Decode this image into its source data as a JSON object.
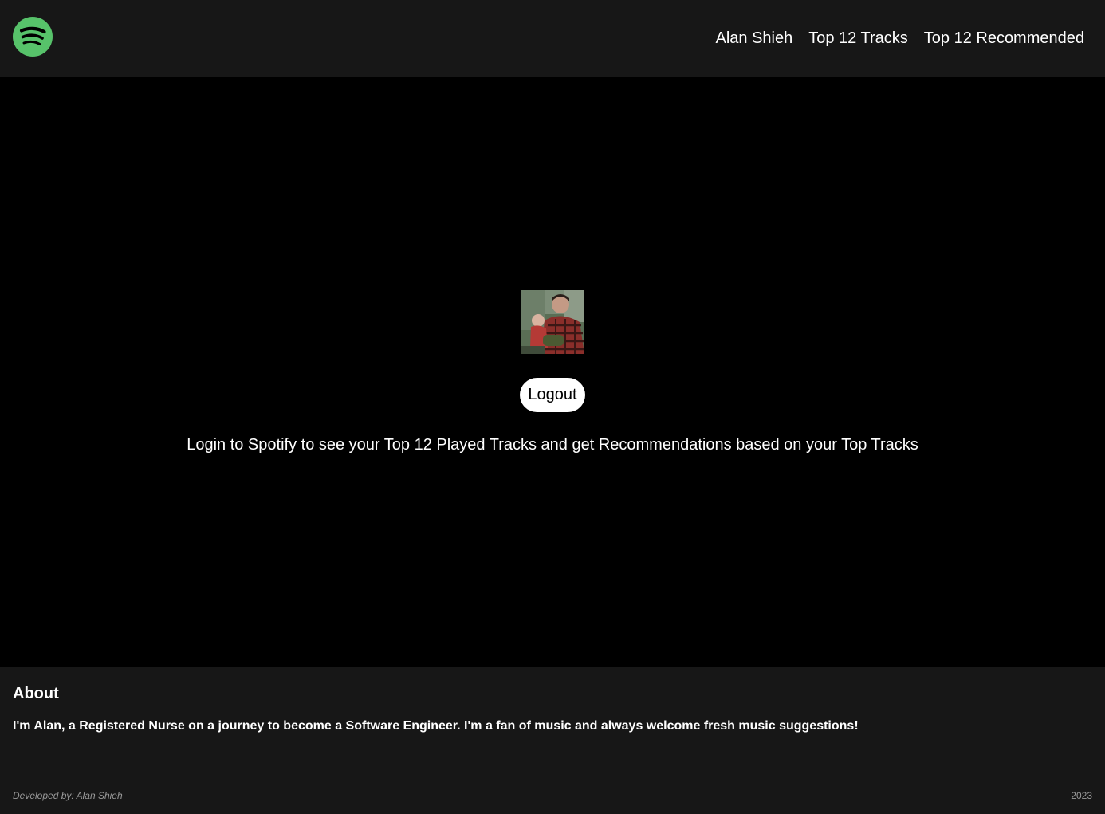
{
  "header": {
    "logo_icon": "spotify-logo-icon",
    "nav": [
      {
        "label": "Alan Shieh"
      },
      {
        "label": "Top 12 Tracks"
      },
      {
        "label": "Top 12 Recommended"
      }
    ]
  },
  "main": {
    "avatar_alt": "profile photo",
    "logout_label": "Logout",
    "message": "Login to Spotify to see your Top 12 Played Tracks and get Recommendations based on your Top Tracks"
  },
  "footer": {
    "about_title": "About",
    "about_text": "I'm Alan, a Registered Nurse on a journey to become a Software Engineer. I'm a fan of music and always welcome fresh music suggestions!",
    "developed_by": "Developed by: Alan Shieh",
    "year": "2023"
  },
  "colors": {
    "header_bg": "#171717",
    "page_bg": "#000000",
    "spotify_green": "#1ed760",
    "logo_green": "#57c26a"
  }
}
